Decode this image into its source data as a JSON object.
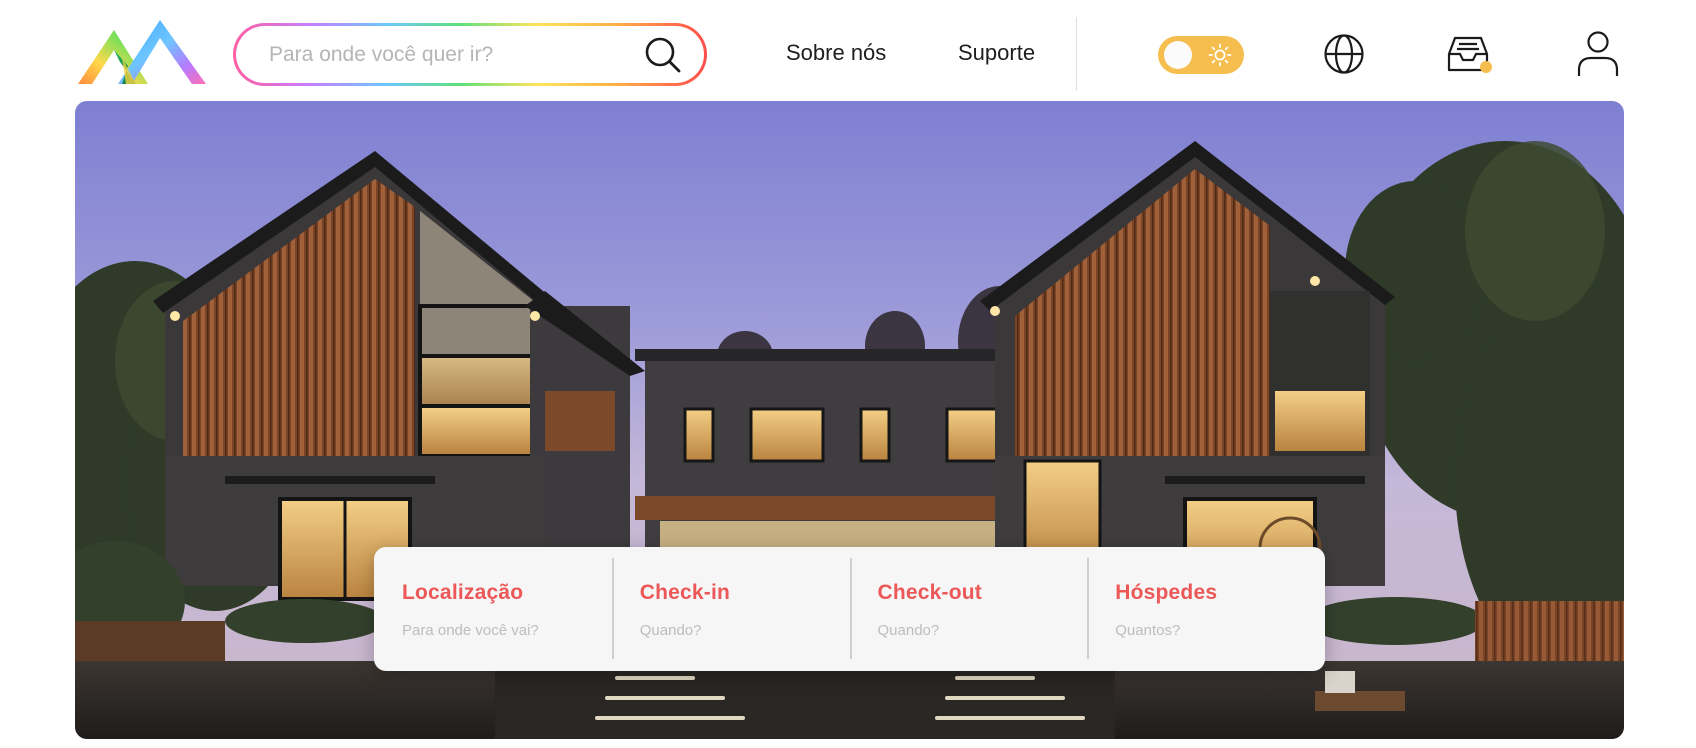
{
  "header": {
    "search": {
      "placeholder": "Para onde você quer ir?",
      "value": ""
    },
    "nav": [
      {
        "label": "Sobre nós"
      },
      {
        "label": "Suporte"
      }
    ],
    "theme_toggle": {
      "mode": "light",
      "icon": "sun-icon"
    },
    "icons": [
      "globe-icon",
      "inbox-icon",
      "user-icon"
    ],
    "inbox_notification": true
  },
  "booking": {
    "fields": [
      {
        "label": "Localização",
        "hint": "Para onde você vai?"
      },
      {
        "label": "Check-in",
        "hint": "Quando?"
      },
      {
        "label": "Check-out",
        "hint": "Quando?"
      },
      {
        "label": "Hóspedes",
        "hint": "Quantos?"
      }
    ]
  },
  "colors": {
    "accent_red": "#ec5757",
    "toggle_yellow": "#f6be4e",
    "text_dark": "#1e1e1e",
    "hint_gray": "#bdbdbd"
  }
}
